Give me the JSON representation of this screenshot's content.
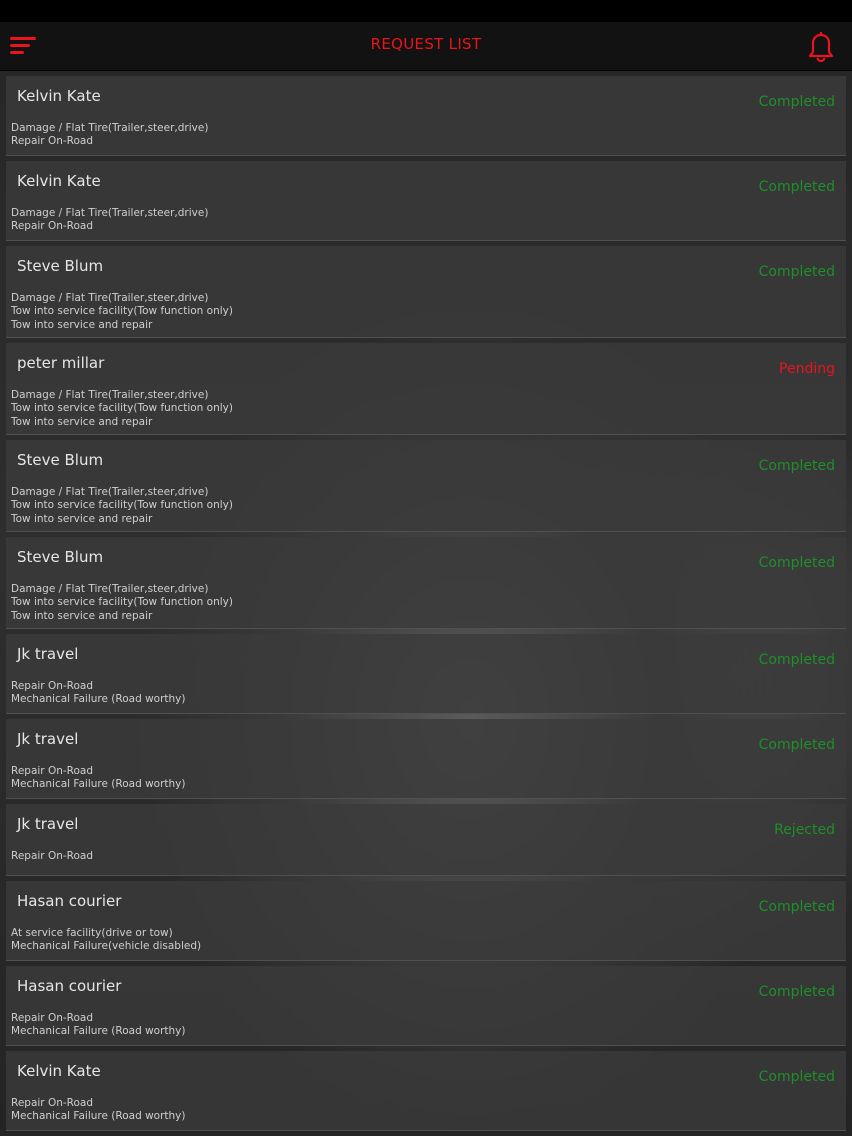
{
  "header": {
    "title": "REQUEST LIST"
  },
  "colors": {
    "accent": "#e8141e",
    "completed": "#1f8f2a",
    "pending": "#e8141e",
    "rejected": "#1f8f2a"
  },
  "icons": {
    "menu": "menu-icon",
    "notifications": "bell-icon"
  },
  "requests": [
    {
      "name": "Kelvin Kate",
      "status": "Completed",
      "status_type": "completed",
      "details": [
        "Damage / Flat Tire(Trailer,steer,drive)",
        "Repair On-Road"
      ]
    },
    {
      "name": "Kelvin Kate",
      "status": "Completed",
      "status_type": "completed",
      "details": [
        "Damage / Flat Tire(Trailer,steer,drive)",
        "Repair On-Road"
      ]
    },
    {
      "name": "Steve Blum",
      "status": "Completed",
      "status_type": "completed",
      "details": [
        "Damage / Flat Tire(Trailer,steer,drive)",
        "Tow into service facility(Tow function only)",
        "Tow into service and repair"
      ]
    },
    {
      "name": "peter millar",
      "status": "Pending",
      "status_type": "pending",
      "details": [
        "Damage / Flat Tire(Trailer,steer,drive)",
        "Tow into service facility(Tow function only)",
        "Tow into service and repair"
      ]
    },
    {
      "name": "Steve Blum",
      "status": "Completed",
      "status_type": "completed",
      "details": [
        "Damage / Flat Tire(Trailer,steer,drive)",
        "Tow into service facility(Tow function only)",
        "Tow into service and repair"
      ]
    },
    {
      "name": "Steve Blum",
      "status": "Completed",
      "status_type": "completed",
      "details": [
        "Damage / Flat Tire(Trailer,steer,drive)",
        "Tow into service facility(Tow function only)",
        "Tow into service and repair"
      ]
    },
    {
      "name": "Jk travel",
      "status": "Completed",
      "status_type": "completed",
      "details": [
        "Repair On-Road",
        "Mechanical Failure (Road worthy)"
      ]
    },
    {
      "name": "Jk travel",
      "status": "Completed",
      "status_type": "completed",
      "details": [
        "Repair On-Road",
        "Mechanical Failure (Road worthy)"
      ]
    },
    {
      "name": "Jk travel",
      "status": "Rejected",
      "status_type": "rejected",
      "details": [
        "Repair On-Road"
      ]
    },
    {
      "name": "Hasan courier",
      "status": "Completed",
      "status_type": "completed",
      "details": [
        "At service facility(drive or tow)",
        "Mechanical Failure(vehicle disabled)"
      ]
    },
    {
      "name": "Hasan courier",
      "status": "Completed",
      "status_type": "completed",
      "details": [
        "Repair On-Road",
        "Mechanical Failure (Road worthy)"
      ]
    },
    {
      "name": "Kelvin Kate",
      "status": "Completed",
      "status_type": "completed",
      "details": [
        "Repair On-Road",
        "Mechanical Failure (Road worthy)"
      ]
    }
  ]
}
